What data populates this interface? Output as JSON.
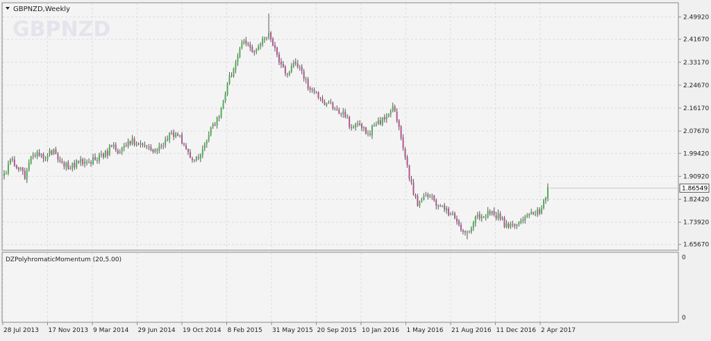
{
  "window": {
    "title": "GBPNZD,Weekly",
    "watermark": "GBPNZD",
    "menu_icon": "triangle-down-icon"
  },
  "indicator": {
    "label": "DZPolyhromaticMomentum (20,5.00)",
    "scale_top": "0",
    "scale_bottom": "0"
  },
  "colors": {
    "background": "#f4f4f4",
    "grid": "#dcdcdc",
    "bull": "#4caf50",
    "bear": "#b0558f",
    "axis_text": "#222222",
    "border": "#888888",
    "price_tag_bg": "#ffffff",
    "price_tag_border": "#555555"
  },
  "chart_data": [
    {
      "type": "candlestick",
      "title": "GBPNZD,Weekly",
      "timeframe": "Weekly",
      "ylim": [
        1.6457,
        2.5417
      ],
      "y_ticks": [
        "2.49920",
        "2.41670",
        "2.33170",
        "2.24670",
        "2.16170",
        "2.07670",
        "1.99420",
        "1.90920",
        "1.82420",
        "1.73920",
        "1.65670"
      ],
      "x_ticks": [
        "28 Jul 2013",
        "17 Nov 2013",
        "9 Mar 2014",
        "29 Jun 2014",
        "19 Oct 2014",
        "8 Feb 2015",
        "31 May 2015",
        "20 Sep 2015",
        "10 Jan 2016",
        "1 May 2016",
        "21 Aug 2016",
        "11 Dec 2016",
        "2 Apr 2017"
      ],
      "current_price": "1.86549",
      "grid": true,
      "close_anchors": [
        [
          0,
          1.92
        ],
        [
          4,
          1.97
        ],
        [
          8,
          1.94
        ],
        [
          10,
          1.9
        ],
        [
          12,
          1.96
        ],
        [
          16,
          2.0
        ],
        [
          18,
          1.99
        ],
        [
          20,
          1.97
        ],
        [
          24,
          2.01
        ],
        [
          28,
          1.96
        ],
        [
          32,
          1.94
        ],
        [
          36,
          1.96
        ],
        [
          40,
          1.96
        ],
        [
          44,
          1.97
        ],
        [
          48,
          1.98
        ],
        [
          52,
          2.02
        ],
        [
          56,
          2.0
        ],
        [
          60,
          2.04
        ],
        [
          64,
          2.03
        ],
        [
          68,
          2.02
        ],
        [
          70,
          2.02
        ],
        [
          72,
          2.0
        ],
        [
          76,
          2.02
        ],
        [
          80,
          2.07
        ],
        [
          84,
          2.06
        ],
        [
          88,
          2.01
        ],
        [
          92,
          1.97
        ],
        [
          96,
          2.01
        ],
        [
          100,
          2.09
        ],
        [
          104,
          2.13
        ],
        [
          108,
          2.25
        ],
        [
          112,
          2.33
        ],
        [
          116,
          2.41
        ],
        [
          120,
          2.37
        ],
        [
          124,
          2.4
        ],
        [
          128,
          2.44
        ],
        [
          132,
          2.36
        ],
        [
          136,
          2.29
        ],
        [
          140,
          2.33
        ],
        [
          144,
          2.3
        ],
        [
          148,
          2.23
        ],
        [
          152,
          2.2
        ],
        [
          156,
          2.18
        ],
        [
          160,
          2.16
        ],
        [
          164,
          2.15
        ],
        [
          168,
          2.09
        ],
        [
          172,
          2.1
        ],
        [
          176,
          2.07
        ],
        [
          180,
          2.1
        ],
        [
          184,
          2.12
        ],
        [
          188,
          2.17
        ],
        [
          192,
          2.05
        ],
        [
          196,
          1.9
        ],
        [
          200,
          1.8
        ],
        [
          204,
          1.84
        ],
        [
          208,
          1.82
        ],
        [
          212,
          1.8
        ],
        [
          216,
          1.77
        ],
        [
          220,
          1.73
        ],
        [
          224,
          1.7
        ],
        [
          228,
          1.76
        ],
        [
          232,
          1.76
        ],
        [
          236,
          1.78
        ],
        [
          240,
          1.75
        ],
        [
          244,
          1.72
        ],
        [
          248,
          1.73
        ],
        [
          252,
          1.76
        ],
        [
          256,
          1.77
        ],
        [
          260,
          1.79
        ],
        [
          262,
          1.83
        ],
        [
          263,
          1.87
        ]
      ],
      "session_extremes": {
        "high": 2.512,
        "low": 1.6757
      }
    },
    {
      "type": "line",
      "title": "DZPolyhromaticMomentum (20,5.00)",
      "series": [],
      "ylim": [
        0,
        0
      ]
    }
  ]
}
